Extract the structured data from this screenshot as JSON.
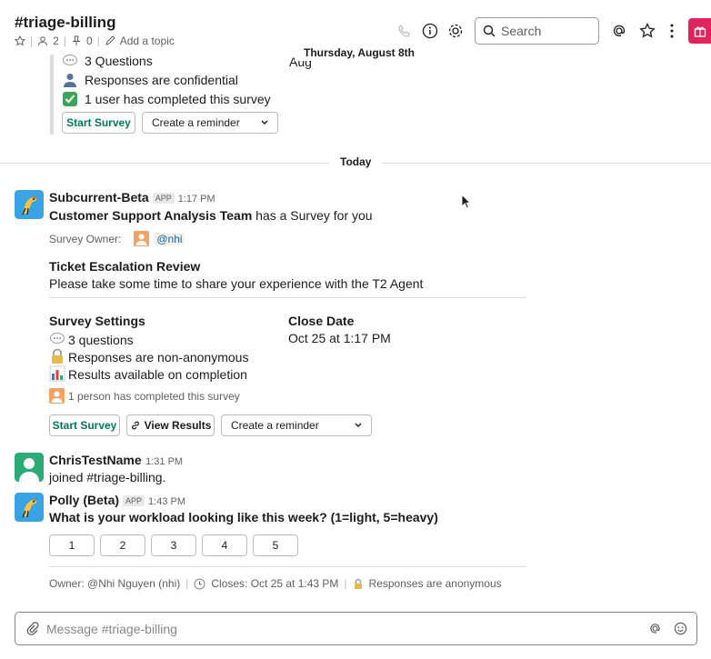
{
  "header": {
    "channel_name": "#triage-billing",
    "members": "2",
    "pins": "0",
    "add_topic": "Add a topic",
    "search_placeholder": "Search"
  },
  "prev_survey": {
    "date_pill": "Thursday, August 8th",
    "aug_fragment": "Aug",
    "questions": "3 Questions",
    "confidential": "Responses are confidential",
    "completed": "1 user has completed this survey",
    "start_button": "Start Survey",
    "reminder_select": "Create a reminder"
  },
  "today_label": "Today",
  "message1": {
    "author": "Subcurrent-Beta",
    "app_tag": "APP",
    "time": "1:17 PM",
    "team": "Customer Support Analysis Team",
    "intro_rest": "has a Survey for you",
    "owner_label": "Survey Owner:",
    "owner_handle": "@nhi",
    "survey_title": "Ticket Escalation Review",
    "survey_desc": "Please take some time to share your experience with the T2 Agent",
    "settings_heading": "Survey Settings",
    "setting_questions": "3 questions",
    "setting_anonymity": "Responses are non-anonymous",
    "setting_results": "Results available on completion",
    "close_heading": "Close Date",
    "close_value": "Oct 25 at 1:17 PM",
    "completed_count": "1 person has completed this survey",
    "start_button": "Start Survey",
    "view_results_button": "View Results",
    "reminder_select": "Create a reminder"
  },
  "message2": {
    "author": "ChrisTestName",
    "time": "1:31 PM",
    "text": "joined #triage-billing."
  },
  "message3": {
    "author": "Polly (Beta)",
    "app_tag": "APP",
    "time": "1:43 PM",
    "question": "What is your workload looking like this week? (1=light, 5=heavy)",
    "options": [
      "1",
      "2",
      "3",
      "4",
      "5"
    ],
    "footer_owner": "Owner: @Nhi Nguyen (nhi)",
    "footer_closes": "Closes: Oct 25 at 1:43 PM",
    "footer_anon": "Responses are anonymous"
  },
  "composer": {
    "placeholder": "Message #triage-billing"
  },
  "colors": {
    "accent_green": "#007a5a",
    "gift_red": "#e0245e",
    "avatar_blue": "#3aa3e3",
    "avatar_green": "#2bac76"
  }
}
